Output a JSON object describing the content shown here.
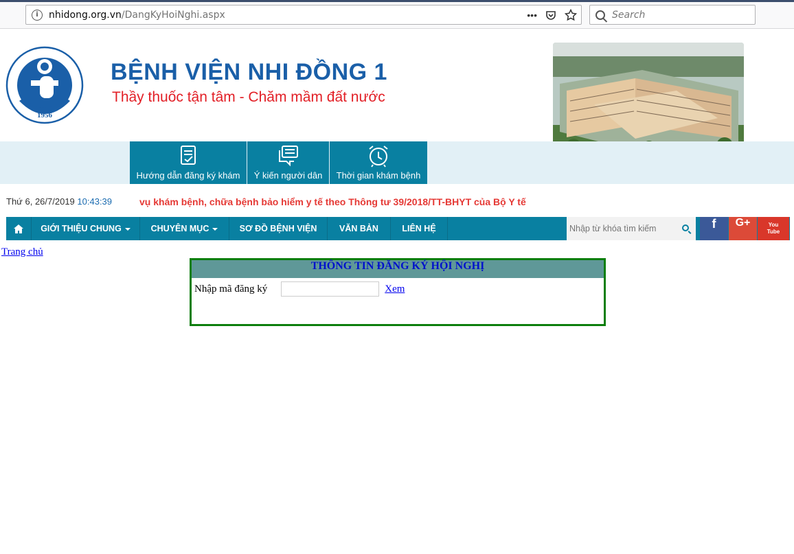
{
  "browser": {
    "url_host": "nhidong.org.vn",
    "url_path": "/DangKyHoiNghi.aspx",
    "search_placeholder": "Search",
    "actions": [
      "•••"
    ]
  },
  "header": {
    "logo_text": "BỆNH VIỆN NHI ĐỒNG 1",
    "logo_year": "1956",
    "title": "BỆNH VIỆN NHI ĐỒNG 1",
    "slogan": "Thầy thuốc tận tâm - Chăm mầm đất nước"
  },
  "quick_links": [
    {
      "label": "Hướng dẫn đăng ký khám",
      "icon": "document-check-icon"
    },
    {
      "label": "Ý kiến người dân",
      "icon": "chat-bubble-icon"
    },
    {
      "label": "Thời gian khám bệnh",
      "icon": "alarm-clock-icon"
    }
  ],
  "datetime": {
    "date": "Thứ 6, 26/7/2019",
    "time": "10:43:39"
  },
  "marquee": "vụ khám bệnh, chữa bệnh bảo hiểm y tế theo Thông tư 39/2018/TT-BHYT của Bộ Y tế",
  "nav": {
    "items": [
      {
        "label": "GIỚI THIỆU CHUNG",
        "dropdown": true
      },
      {
        "label": "CHUYÊN MỤC",
        "dropdown": true
      },
      {
        "label": "SƠ ĐỒ BỆNH VIỆN",
        "dropdown": false
      },
      {
        "label": "VĂN BẢN",
        "dropdown": false
      },
      {
        "label": "LIÊN HỆ",
        "dropdown": false
      }
    ],
    "search_placeholder": "Nhập từ khóa tìm kiếm",
    "social": [
      {
        "name": "facebook",
        "label": "f",
        "color": "#3b5998"
      },
      {
        "name": "google-plus",
        "label": "G+",
        "color": "#dc4a38"
      },
      {
        "name": "youtube",
        "label": "You Tube",
        "color": "#d9372a"
      }
    ]
  },
  "content": {
    "breadcrumb": "Trang chủ",
    "panel_title": "THÔNG TIN ĐĂNG KÝ HỘI NGHỊ",
    "field_label": "Nhập mã đăng ký",
    "field_value": "",
    "submit_link": "Xem"
  },
  "colors": {
    "nav_bg": "#0980a1",
    "band_bg": "#e2f0f6",
    "title_blue": "#1a5fa8",
    "slogan_red": "#e21f26",
    "panel_border": "#0d7e0d",
    "panel_header": "#5f9898"
  }
}
